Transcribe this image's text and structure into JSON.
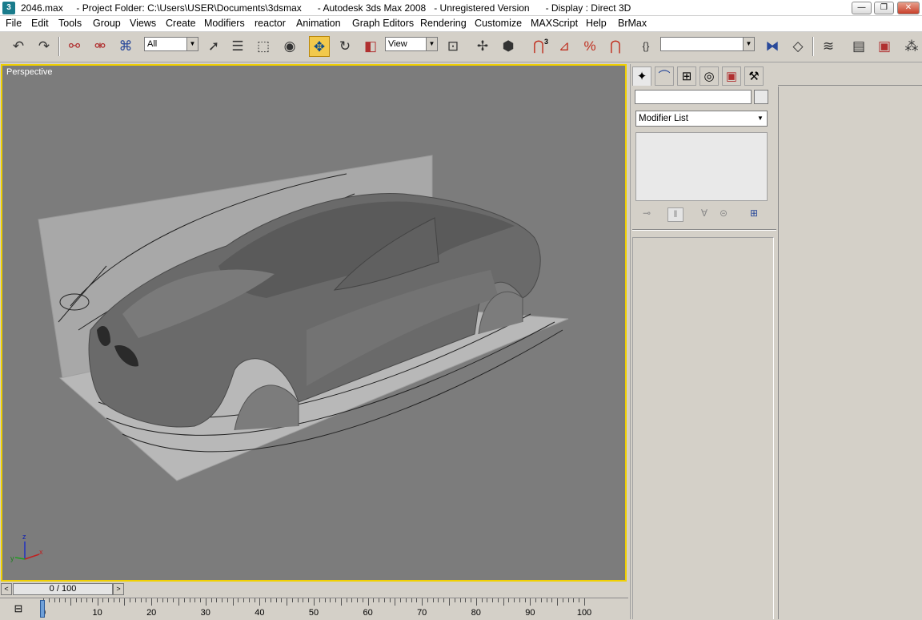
{
  "window": {
    "title": "2046.max     - Project Folder: C:\\Users\\USER\\Documents\\3dsmax      - Autodesk 3ds Max 2008   - Unregistered Version      - Display : Direct 3D",
    "minimize": "—",
    "maximize": "❐",
    "close": "✕"
  },
  "menu": [
    "File",
    "Edit",
    "Tools",
    "Group",
    "Views",
    "Create",
    "Modifiers",
    "reactor",
    "Animation",
    "Graph Editors",
    "Rendering",
    "Customize",
    "MAXScript",
    "Help",
    "BrMax"
  ],
  "toolbar": {
    "selection_filter": "All",
    "ref_coord": "View",
    "named_selection": "",
    "snap_3d": "3"
  },
  "viewport": {
    "label": "Perspective",
    "axis_x": "x",
    "axis_y": "y",
    "axis_z": "z"
  },
  "command_panel": {
    "modifier_list": "Modifier List",
    "object_name": ""
  },
  "timeline": {
    "frame_display": "0 / 100",
    "prev": "<",
    "next": ">",
    "current_frame": 0,
    "ruler_labels": [
      "0",
      "10",
      "20",
      "30",
      "40",
      "50",
      "60",
      "70",
      "80",
      "90",
      "100"
    ]
  },
  "colors": {
    "viewport_bg": "#7c7c7c",
    "active_border": "#f0d000",
    "ui_gray": "#d4d0c8"
  }
}
